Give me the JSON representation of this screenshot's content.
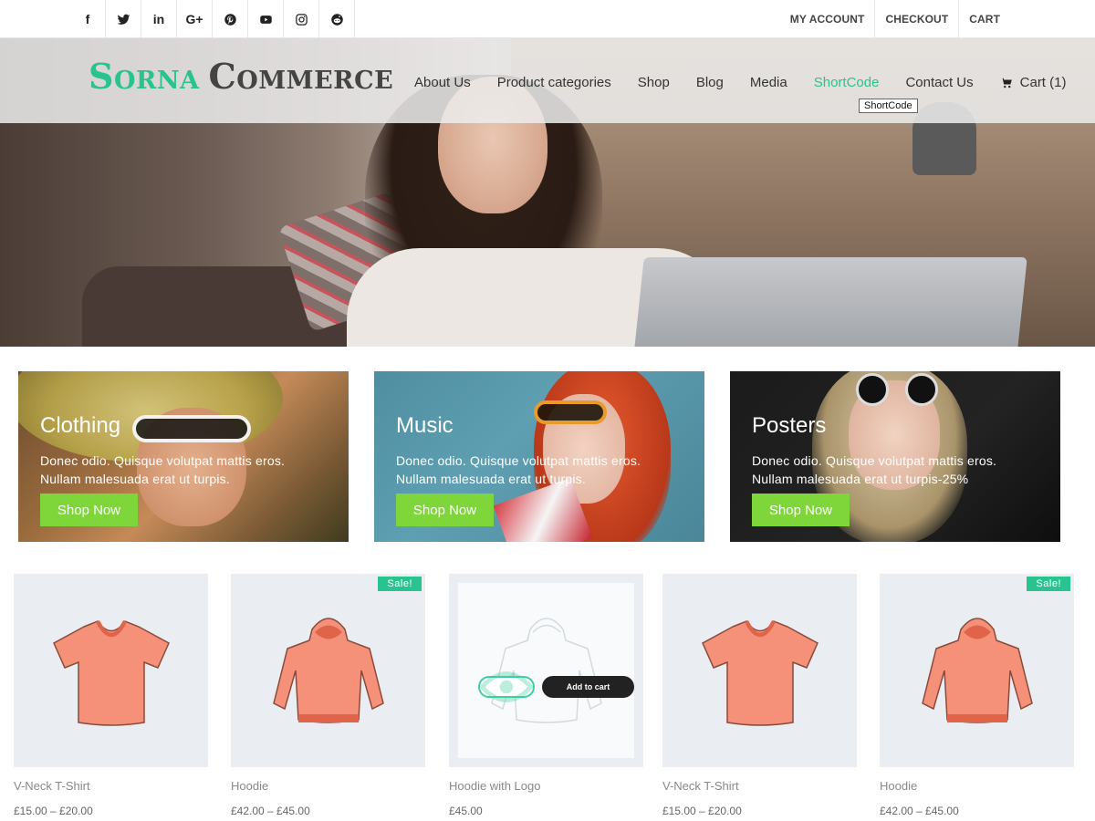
{
  "social": [
    {
      "icon": "facebook-icon",
      "glyph": "f"
    },
    {
      "icon": "twitter-icon",
      "glyph": ""
    },
    {
      "icon": "linkedin-icon",
      "glyph": "in"
    },
    {
      "icon": "google-plus-icon",
      "glyph": "G+"
    },
    {
      "icon": "pinterest-icon",
      "glyph": ""
    },
    {
      "icon": "youtube-icon",
      "glyph": ""
    },
    {
      "icon": "instagram-icon",
      "glyph": ""
    },
    {
      "icon": "reddit-icon",
      "glyph": ""
    }
  ],
  "account_links": [
    "MY ACCOUNT",
    "CHECKOUT",
    "CART"
  ],
  "logo": {
    "part1": "Sorna",
    "part2": "Commerce"
  },
  "nav": {
    "items": [
      "About Us",
      "Product categories",
      "Shop",
      "Blog",
      "Media",
      "ShortCode",
      "Contact Us"
    ],
    "active": "ShortCode",
    "cart": "Cart (1)",
    "tooltip": "ShortCode"
  },
  "banners": [
    {
      "title": "Clothing",
      "line1": "Donec odio. Quisque volutpat mattis eros.",
      "line2": "Nullam malesuada erat ut turpis.",
      "button": "Shop Now"
    },
    {
      "title": "Music",
      "line1": "Donec odio. Quisque volutpat mattis eros.",
      "line2": "Nullam malesuada erat ut turpis.",
      "button": "Shop Now"
    },
    {
      "title": "Posters",
      "line1": "Donec odio. Quisque volutpat mattis eros.",
      "line2": "Nullam malesuada erat ut turpis-25%",
      "button": "Shop Now"
    }
  ],
  "products": [
    {
      "name": "V-Neck T-Shirt",
      "price": "£15.00 – £20.00",
      "sale": "",
      "type": "tshirt"
    },
    {
      "name": "Hoodie",
      "price": "£42.00 – £45.00",
      "sale": "Sale!",
      "type": "hoodie"
    },
    {
      "name": "Hoodie with Logo",
      "price": "£45.00",
      "sale": "",
      "type": "hoodie-outline"
    },
    {
      "name": "V-Neck T-Shirt",
      "price": "£15.00 – £20.00",
      "sale": "",
      "type": "tshirt"
    },
    {
      "name": "Hoodie",
      "price": "£42.00 – £45.00",
      "sale": "Sale!",
      "type": "hoodie"
    }
  ],
  "product_actions": {
    "add_to_cart": "Add to cart",
    "quick_view_icon": "eye-icon"
  },
  "colors": {
    "accent": "#28c38f",
    "button_green": "#7ed63b",
    "garment": "#f59178",
    "garment_trim": "#e0644a"
  }
}
